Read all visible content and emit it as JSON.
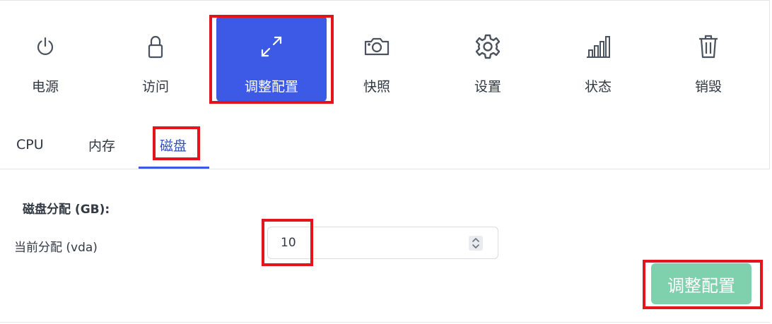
{
  "actions": [
    {
      "key": "power",
      "label": "电源",
      "icon": "power-icon"
    },
    {
      "key": "access",
      "label": "访问",
      "icon": "lock-icon"
    },
    {
      "key": "resize",
      "label": "调整配置",
      "icon": "resize-icon",
      "active": true
    },
    {
      "key": "snapshot",
      "label": "快照",
      "icon": "camera-icon"
    },
    {
      "key": "settings",
      "label": "设置",
      "icon": "gear-icon"
    },
    {
      "key": "status",
      "label": "状态",
      "icon": "bar-chart-icon"
    },
    {
      "key": "destroy",
      "label": "销毁",
      "icon": "trash-icon"
    }
  ],
  "tabs": [
    {
      "label": "CPU"
    },
    {
      "label": "内存"
    },
    {
      "label": "磁盘",
      "active": true
    }
  ],
  "disk": {
    "section_title": "磁盘分配 (GB):",
    "current_label": "当前分配 (vda)",
    "value": "10",
    "submit_label": "调整配置"
  },
  "colors": {
    "accent": "#3c5ae6",
    "tab_active": "#2e4fc9",
    "submit_disabled": "#7fd1ad",
    "highlight": "#e5131c",
    "icon": "#4a525e"
  }
}
